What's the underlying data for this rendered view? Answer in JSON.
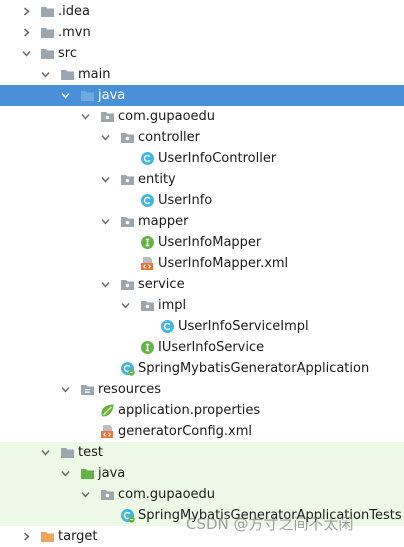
{
  "project_tree": {
    "nodes": [
      {
        "name": ".idea",
        "icon": "folder-icon",
        "state": "collapsed"
      },
      {
        "name": ".mvn",
        "icon": "folder-icon",
        "state": "collapsed"
      },
      {
        "name": "src",
        "icon": "folder-icon",
        "state": "expanded"
      },
      {
        "name": "main",
        "icon": "folder-icon",
        "state": "expanded"
      },
      {
        "name": "java",
        "icon": "source-root-folder-icon",
        "state": "expanded",
        "selected": true
      },
      {
        "name": "com.gupaoedu",
        "icon": "package-icon",
        "state": "expanded"
      },
      {
        "name": "controller",
        "icon": "package-icon",
        "state": "expanded"
      },
      {
        "name": "UserInfoController",
        "icon": "class-icon"
      },
      {
        "name": "entity",
        "icon": "package-icon",
        "state": "expanded"
      },
      {
        "name": "UserInfo",
        "icon": "class-icon"
      },
      {
        "name": "mapper",
        "icon": "package-icon",
        "state": "expanded"
      },
      {
        "name": "UserInfoMapper",
        "icon": "interface-icon"
      },
      {
        "name": "UserInfoMapper.xml",
        "icon": "xml-file-icon"
      },
      {
        "name": "service",
        "icon": "package-icon",
        "state": "expanded"
      },
      {
        "name": "impl",
        "icon": "package-icon",
        "state": "expanded"
      },
      {
        "name": "UserInfoServiceImpl",
        "icon": "class-icon"
      },
      {
        "name": "IUserInfoService",
        "icon": "interface-icon"
      },
      {
        "name": "SpringMybatisGeneratorApplication",
        "icon": "spring-boot-class-icon"
      },
      {
        "name": "resources",
        "icon": "resources-folder-icon",
        "state": "expanded"
      },
      {
        "name": "application.properties",
        "icon": "spring-properties-icon"
      },
      {
        "name": "generatorConfig.xml",
        "icon": "xml-file-icon"
      },
      {
        "name": "test",
        "icon": "folder-icon",
        "state": "expanded"
      },
      {
        "name": "java",
        "icon": "test-source-folder-icon",
        "state": "expanded"
      },
      {
        "name": "com.gupaoedu",
        "icon": "package-icon",
        "state": "expanded"
      },
      {
        "name": "SpringMybatisGeneratorApplicationTests",
        "icon": "spring-boot-class-icon"
      },
      {
        "name": "target",
        "icon": "excluded-folder-icon",
        "state": "collapsed"
      }
    ]
  },
  "watermark": "CSDN @方寸之间不太闲",
  "colors": {
    "selection": "#4a90d9",
    "test_background": "#eef8e6",
    "folder": "#9aa7b0",
    "source_folder": "#6fa9e0",
    "test_folder": "#62b543",
    "excluded_folder": "#f0a35a",
    "class": "#40b6e0",
    "interface": "#62b543",
    "xml": "#e8763c"
  }
}
